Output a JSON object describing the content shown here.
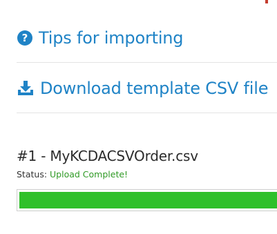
{
  "links": {
    "tips_label": "Tips for importing",
    "tips_icon": "question-circle-icon",
    "download_label": "Download template CSV file",
    "download_icon": "download-icon"
  },
  "upload": {
    "file_label": "#1 - MyKCDACSVOrder.csv",
    "status_label": "Status:",
    "status_value": "Upload Complete!",
    "progress_fraction": 1.0
  },
  "colors": {
    "link": "#1f83c6",
    "status_success": "#2f9a25",
    "progress_fill": "#2fc02a"
  }
}
